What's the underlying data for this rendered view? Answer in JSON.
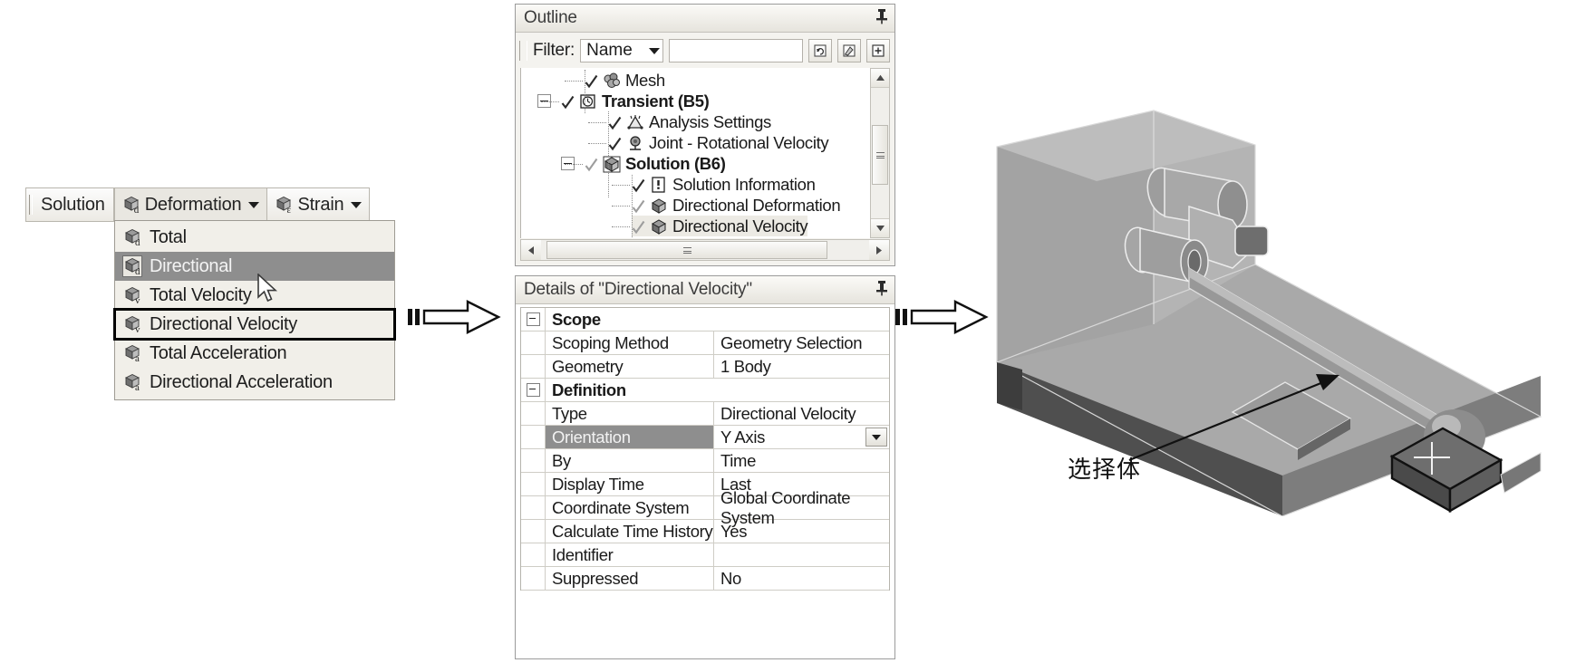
{
  "toolbar": {
    "solution_label": "Solution",
    "deformation_label": "Deformation",
    "strain_label": "Strain",
    "deformation_icon_sub": "d",
    "strain_icon_sub": "ε"
  },
  "dropdown_menu": {
    "items": [
      {
        "label": "Total",
        "sub": "d",
        "state": "normal"
      },
      {
        "label": "Directional",
        "sub": "d",
        "state": "selected"
      },
      {
        "label": "Total Velocity",
        "sub": "v",
        "state": "normal"
      },
      {
        "label": "Directional Velocity",
        "sub": "v",
        "state": "boxed"
      },
      {
        "label": "Total Acceleration",
        "sub": "a",
        "state": "normal"
      },
      {
        "label": "Directional Acceleration",
        "sub": "a",
        "state": "normal"
      }
    ]
  },
  "outline": {
    "title": "Outline",
    "pin": "中",
    "filter": {
      "label": "Filter:",
      "mode": "Name",
      "text_value": "",
      "placeholder": "",
      "buttons": [
        "refresh-icon",
        "highlight-icon",
        "expand-icon"
      ]
    },
    "tree": [
      {
        "label": "Mesh",
        "depth": 2,
        "icon": "mesh-icon",
        "check": true,
        "bold": false,
        "expander": null,
        "selected": false
      },
      {
        "label": "Transient (B5)",
        "depth": 1,
        "icon": "transient-clock-icon",
        "check": true,
        "bold": true,
        "expander": "minus",
        "selected": false
      },
      {
        "label": "Analysis Settings",
        "depth": 3,
        "icon": "analysis-settings-icon",
        "check": true,
        "bold": false,
        "expander": null,
        "selected": false
      },
      {
        "label": "Joint - Rotational Velocity",
        "depth": 3,
        "icon": "joint-rotational-velocity-icon",
        "check": true,
        "bold": false,
        "expander": null,
        "selected": false
      },
      {
        "label": "Solution (B6)",
        "depth": 2,
        "icon": "solution-cube-icon",
        "check": "partial",
        "bold": true,
        "expander": "minus",
        "selected": false
      },
      {
        "label": "Solution Information",
        "depth": 4,
        "icon": "solution-information-icon",
        "check": true,
        "bold": false,
        "expander": null,
        "selected": false
      },
      {
        "label": "Directional Deformation",
        "depth": 4,
        "icon": "result-cube-icon",
        "check": "partial",
        "bold": false,
        "expander": null,
        "selected": false
      },
      {
        "label": "Directional Velocity",
        "depth": 4,
        "icon": "result-cube-icon",
        "check": "partial",
        "bold": false,
        "expander": null,
        "selected": true
      }
    ]
  },
  "details": {
    "title": "Details of \"Directional Velocity\"",
    "pin": "中",
    "rows": [
      {
        "kind": "group",
        "name": "Scope",
        "value": ""
      },
      {
        "kind": "row",
        "name": "Scoping Method",
        "value": "Geometry Selection"
      },
      {
        "kind": "row",
        "name": "Geometry",
        "value": "1 Body"
      },
      {
        "kind": "group",
        "name": "Definition",
        "value": ""
      },
      {
        "kind": "row",
        "name": "Type",
        "value": "Directional Velocity"
      },
      {
        "kind": "row",
        "name": "Orientation",
        "value": "Y Axis",
        "highlight": true,
        "dropdown": true
      },
      {
        "kind": "row",
        "name": "By",
        "value": "Time"
      },
      {
        "kind": "row",
        "name": "Display Time",
        "value": "Last"
      },
      {
        "kind": "row",
        "name": "Coordinate System",
        "value": "Global Coordinate System"
      },
      {
        "kind": "row",
        "name": "Calculate Time History",
        "value": "Yes"
      },
      {
        "kind": "row",
        "name": "Identifier",
        "value": ""
      },
      {
        "kind": "row",
        "name": "Suppressed",
        "value": "No"
      }
    ]
  },
  "annotation": {
    "callout_label": "选择体"
  },
  "colors": {
    "selection_gray": "#8e8e8e",
    "panel_bg": "#f4f3ef",
    "border": "#9b9b9b",
    "model_light": "#b5b5b5",
    "model_mid": "#9a9a9a",
    "model_dark": "#5c5c5c"
  }
}
